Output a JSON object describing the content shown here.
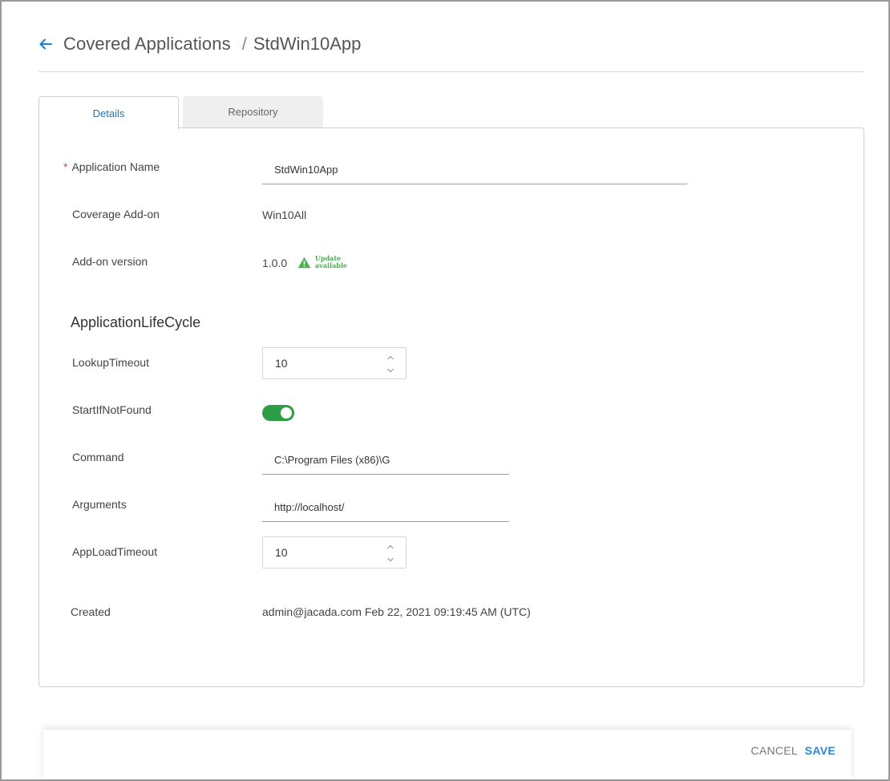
{
  "header": {
    "back_icon": "arrow-left-icon",
    "breadcrumb_parent": "Covered Applications",
    "breadcrumb_separator": "/",
    "breadcrumb_current": "StdWin10App"
  },
  "tabs": [
    {
      "label": "Details",
      "active": true
    },
    {
      "label": "Repository",
      "active": false
    }
  ],
  "details": {
    "application_name": {
      "label": "Application Name",
      "required_mark": "*",
      "value": "StdWin10App"
    },
    "coverage_addon": {
      "label": "Coverage Add-on",
      "value": "Win10All"
    },
    "addon_version": {
      "label": "Add-on version",
      "value": "1.0.0",
      "update_line1": "Update",
      "update_line2": "available",
      "update_icon": "warning-triangle-icon"
    },
    "section_title": "ApplicationLifeCycle",
    "lookup_timeout": {
      "label": "LookupTimeout",
      "value": "10"
    },
    "start_if_not_found": {
      "label": "StartIfNotFound",
      "enabled": true
    },
    "command": {
      "label": "Command",
      "value": "C:\\Program Files (x86)\\G"
    },
    "arguments": {
      "label": "Arguments",
      "value": "http://localhost/"
    },
    "app_load_timeout": {
      "label": "AppLoadTimeout",
      "value": "10"
    },
    "created": {
      "label": "Created",
      "value": "admin@jacada.com Feb 22, 2021 09:19:45 AM (UTC)"
    }
  },
  "footer": {
    "cancel_label": "CANCEL",
    "save_label": "SAVE"
  },
  "colors": {
    "accent": "#1b77c4",
    "toggle_on": "#2e9e46",
    "update_green": "#4caf50",
    "required": "#e04040"
  }
}
